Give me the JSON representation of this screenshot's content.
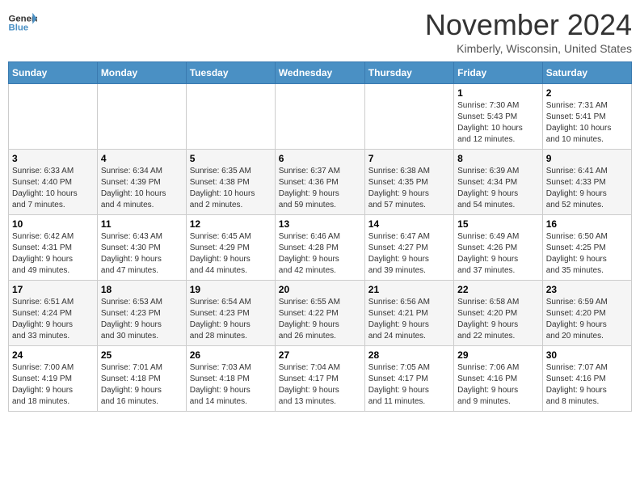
{
  "header": {
    "logo_line1": "General",
    "logo_line2": "Blue",
    "month": "November 2024",
    "location": "Kimberly, Wisconsin, United States"
  },
  "weekdays": [
    "Sunday",
    "Monday",
    "Tuesday",
    "Wednesday",
    "Thursday",
    "Friday",
    "Saturday"
  ],
  "weeks": [
    [
      {
        "day": "",
        "info": ""
      },
      {
        "day": "",
        "info": ""
      },
      {
        "day": "",
        "info": ""
      },
      {
        "day": "",
        "info": ""
      },
      {
        "day": "",
        "info": ""
      },
      {
        "day": "1",
        "info": "Sunrise: 7:30 AM\nSunset: 5:43 PM\nDaylight: 10 hours\nand 12 minutes."
      },
      {
        "day": "2",
        "info": "Sunrise: 7:31 AM\nSunset: 5:41 PM\nDaylight: 10 hours\nand 10 minutes."
      }
    ],
    [
      {
        "day": "3",
        "info": "Sunrise: 6:33 AM\nSunset: 4:40 PM\nDaylight: 10 hours\nand 7 minutes."
      },
      {
        "day": "4",
        "info": "Sunrise: 6:34 AM\nSunset: 4:39 PM\nDaylight: 10 hours\nand 4 minutes."
      },
      {
        "day": "5",
        "info": "Sunrise: 6:35 AM\nSunset: 4:38 PM\nDaylight: 10 hours\nand 2 minutes."
      },
      {
        "day": "6",
        "info": "Sunrise: 6:37 AM\nSunset: 4:36 PM\nDaylight: 9 hours\nand 59 minutes."
      },
      {
        "day": "7",
        "info": "Sunrise: 6:38 AM\nSunset: 4:35 PM\nDaylight: 9 hours\nand 57 minutes."
      },
      {
        "day": "8",
        "info": "Sunrise: 6:39 AM\nSunset: 4:34 PM\nDaylight: 9 hours\nand 54 minutes."
      },
      {
        "day": "9",
        "info": "Sunrise: 6:41 AM\nSunset: 4:33 PM\nDaylight: 9 hours\nand 52 minutes."
      }
    ],
    [
      {
        "day": "10",
        "info": "Sunrise: 6:42 AM\nSunset: 4:31 PM\nDaylight: 9 hours\nand 49 minutes."
      },
      {
        "day": "11",
        "info": "Sunrise: 6:43 AM\nSunset: 4:30 PM\nDaylight: 9 hours\nand 47 minutes."
      },
      {
        "day": "12",
        "info": "Sunrise: 6:45 AM\nSunset: 4:29 PM\nDaylight: 9 hours\nand 44 minutes."
      },
      {
        "day": "13",
        "info": "Sunrise: 6:46 AM\nSunset: 4:28 PM\nDaylight: 9 hours\nand 42 minutes."
      },
      {
        "day": "14",
        "info": "Sunrise: 6:47 AM\nSunset: 4:27 PM\nDaylight: 9 hours\nand 39 minutes."
      },
      {
        "day": "15",
        "info": "Sunrise: 6:49 AM\nSunset: 4:26 PM\nDaylight: 9 hours\nand 37 minutes."
      },
      {
        "day": "16",
        "info": "Sunrise: 6:50 AM\nSunset: 4:25 PM\nDaylight: 9 hours\nand 35 minutes."
      }
    ],
    [
      {
        "day": "17",
        "info": "Sunrise: 6:51 AM\nSunset: 4:24 PM\nDaylight: 9 hours\nand 33 minutes."
      },
      {
        "day": "18",
        "info": "Sunrise: 6:53 AM\nSunset: 4:23 PM\nDaylight: 9 hours\nand 30 minutes."
      },
      {
        "day": "19",
        "info": "Sunrise: 6:54 AM\nSunset: 4:23 PM\nDaylight: 9 hours\nand 28 minutes."
      },
      {
        "day": "20",
        "info": "Sunrise: 6:55 AM\nSunset: 4:22 PM\nDaylight: 9 hours\nand 26 minutes."
      },
      {
        "day": "21",
        "info": "Sunrise: 6:56 AM\nSunset: 4:21 PM\nDaylight: 9 hours\nand 24 minutes."
      },
      {
        "day": "22",
        "info": "Sunrise: 6:58 AM\nSunset: 4:20 PM\nDaylight: 9 hours\nand 22 minutes."
      },
      {
        "day": "23",
        "info": "Sunrise: 6:59 AM\nSunset: 4:20 PM\nDaylight: 9 hours\nand 20 minutes."
      }
    ],
    [
      {
        "day": "24",
        "info": "Sunrise: 7:00 AM\nSunset: 4:19 PM\nDaylight: 9 hours\nand 18 minutes."
      },
      {
        "day": "25",
        "info": "Sunrise: 7:01 AM\nSunset: 4:18 PM\nDaylight: 9 hours\nand 16 minutes."
      },
      {
        "day": "26",
        "info": "Sunrise: 7:03 AM\nSunset: 4:18 PM\nDaylight: 9 hours\nand 14 minutes."
      },
      {
        "day": "27",
        "info": "Sunrise: 7:04 AM\nSunset: 4:17 PM\nDaylight: 9 hours\nand 13 minutes."
      },
      {
        "day": "28",
        "info": "Sunrise: 7:05 AM\nSunset: 4:17 PM\nDaylight: 9 hours\nand 11 minutes."
      },
      {
        "day": "29",
        "info": "Sunrise: 7:06 AM\nSunset: 4:16 PM\nDaylight: 9 hours\nand 9 minutes."
      },
      {
        "day": "30",
        "info": "Sunrise: 7:07 AM\nSunset: 4:16 PM\nDaylight: 9 hours\nand 8 minutes."
      }
    ]
  ]
}
